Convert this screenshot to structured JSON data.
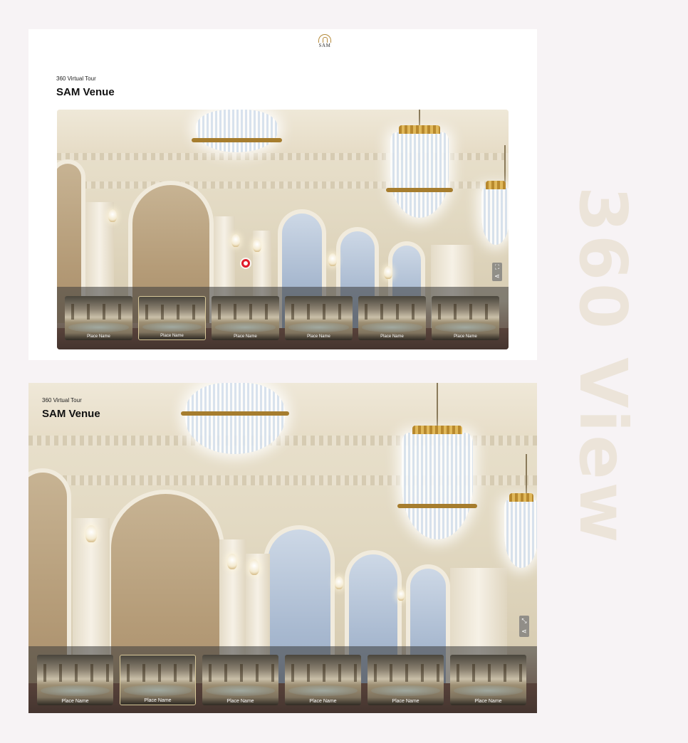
{
  "side_heading": "360 View",
  "brand": {
    "logo_text": "SAM"
  },
  "tour": {
    "eyebrow": "360 Virtual Tour",
    "title": "SAM Venue"
  },
  "thumbnails": [
    {
      "label": "Place Name",
      "active": false
    },
    {
      "label": "Place Name",
      "active": true
    },
    {
      "label": "Place Name",
      "active": false
    },
    {
      "label": "Place Name",
      "active": false
    },
    {
      "label": "Place Name",
      "active": false
    },
    {
      "label": "Place Name",
      "active": false
    }
  ],
  "controls": {
    "fullscreen_icon": "fullscreen-icon",
    "exit_fullscreen_icon": "exit-fullscreen-icon",
    "share_icon": "share-icon"
  },
  "colors": {
    "background": "#f7f3f5",
    "hotspot": "#e01b2a",
    "logo_gold": "#b58a3a",
    "side_text": "#ece4d9"
  }
}
